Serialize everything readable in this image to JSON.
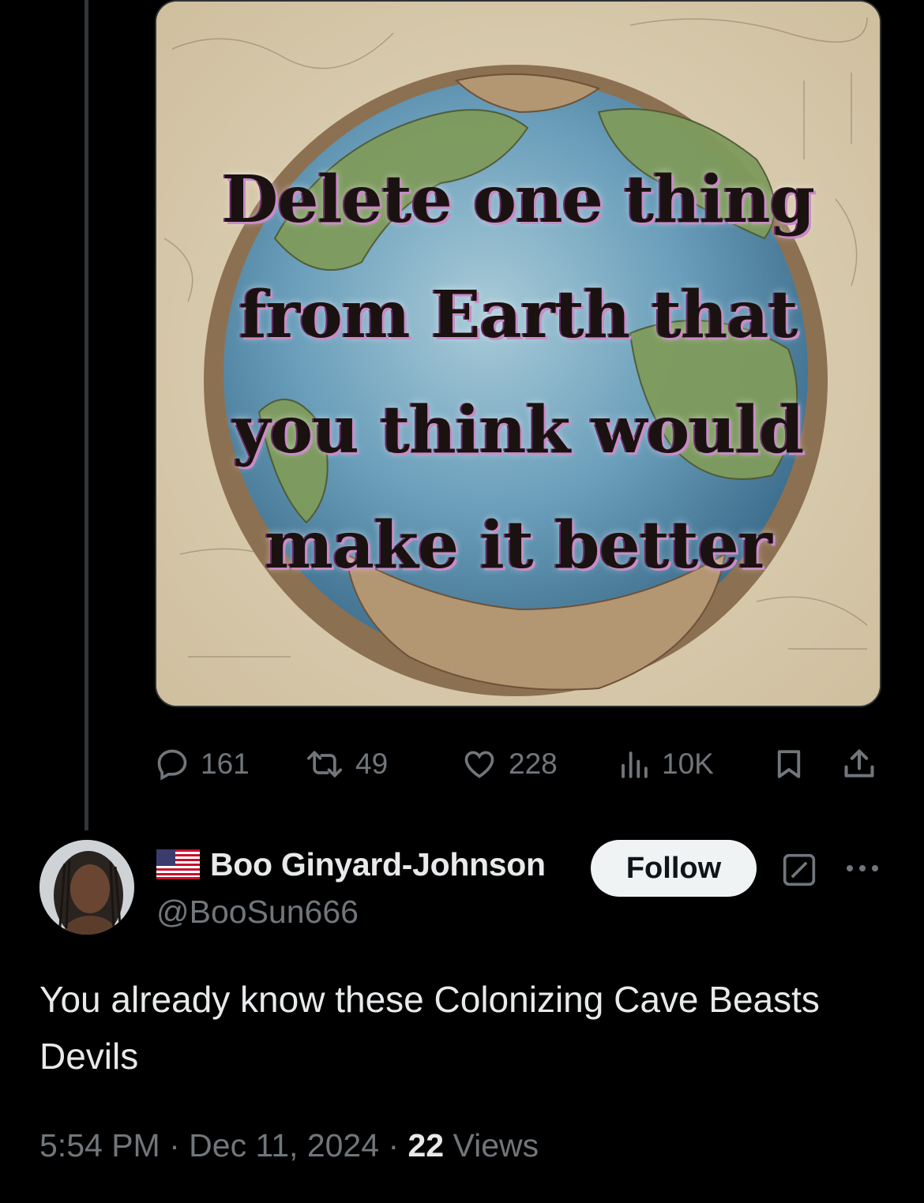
{
  "post": {
    "image_text": "Delete one thing from Earth that you think would make it better",
    "image_lines": [
      "Delete one thing",
      "from Earth that",
      "you think would",
      "make it better"
    ],
    "stats": {
      "replies": "161",
      "reposts": "49",
      "likes": "228",
      "views": "10K"
    }
  },
  "reply": {
    "display_name": "Boo Ginyard-Johnson",
    "handle": "@BooSun666",
    "follow_label": "Follow",
    "text": "You already know these Colonizing Cave Beasts Devils",
    "time": "5:54 PM",
    "date": "Dec 11, 2024",
    "views_count": "22",
    "views_label": "Views",
    "separator": "·"
  },
  "icons": {
    "reply": "reply-icon",
    "repost": "repost-icon",
    "like": "heart-icon",
    "views": "analytics-icon",
    "bookmark": "bookmark-icon",
    "share": "share-icon",
    "flag": "us-flag-icon",
    "grok": "grok-icon",
    "more": "more-icon"
  },
  "colors": {
    "background": "#000000",
    "text": "#e7e9ea",
    "secondary": "#71767b",
    "follow_bg": "#eff3f4",
    "divider": "#2f3336"
  }
}
